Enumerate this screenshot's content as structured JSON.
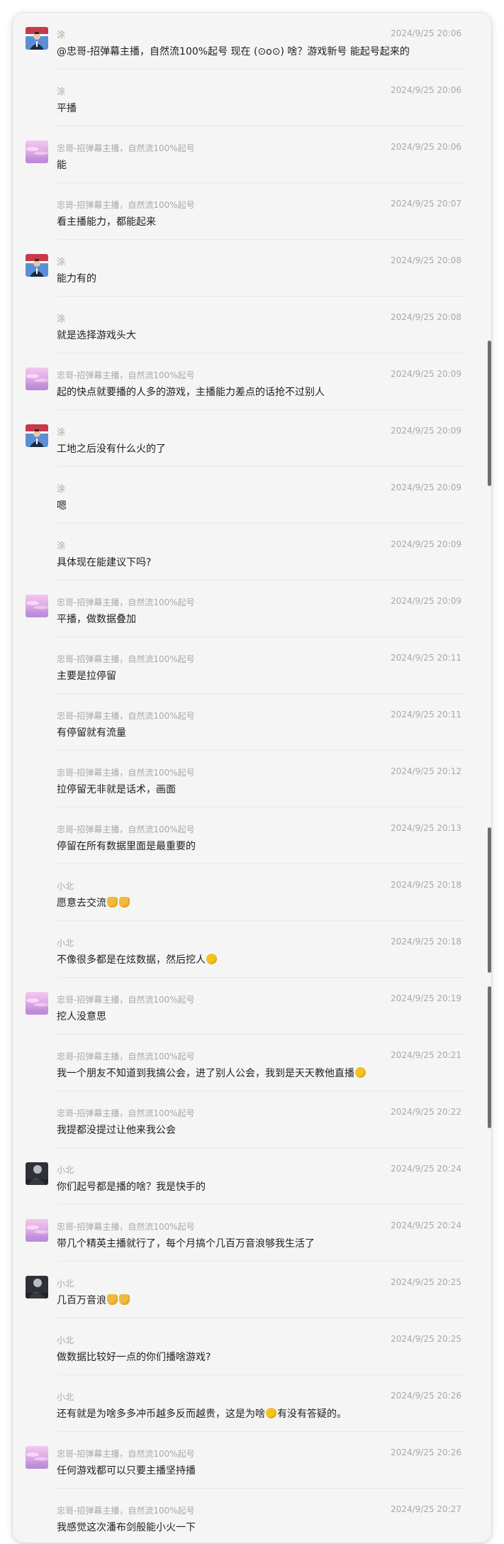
{
  "avatars": {
    "tu": "flag-portrait",
    "zhongge": "pink-sky",
    "xiaobei": "dark-figure"
  },
  "messages": [
    {
      "avatar": "tu",
      "sender": "涂",
      "time": "2024/9/25 20:06",
      "text": "@忠哥-招弹幕主播，自然流100%起号 现在 (⊙o⊙) 啥？游戏新号  能起号起来的"
    },
    {
      "avatar": "",
      "sender": "涂",
      "time": "2024/9/25 20:06",
      "text": "平播"
    },
    {
      "avatar": "zhongge",
      "sender": "忠哥-招弹幕主播，自然流100%起号",
      "time": "2024/9/25 20:06",
      "text": "能"
    },
    {
      "avatar": "",
      "sender": "忠哥-招弹幕主播，自然流100%起号",
      "time": "2024/9/25 20:07",
      "text": "看主播能力，都能起来"
    },
    {
      "avatar": "tu",
      "sender": "涂",
      "time": "2024/9/25 20:08",
      "text": "能力有的"
    },
    {
      "avatar": "",
      "sender": "涂",
      "time": "2024/9/25 20:08",
      "text": "就是选择游戏头大"
    },
    {
      "avatar": "zhongge",
      "sender": "忠哥-招弹幕主播，自然流100%起号",
      "time": "2024/9/25 20:09",
      "text": "起的快点就要播的人多的游戏，主播能力差点的话抢不过别人"
    },
    {
      "avatar": "tu",
      "sender": "涂",
      "time": "2024/9/25 20:09",
      "text": "工地之后没有什么火的了"
    },
    {
      "avatar": "",
      "sender": "涂",
      "time": "2024/9/25 20:09",
      "text": "嗯"
    },
    {
      "avatar": "",
      "sender": "涂",
      "time": "2024/9/25 20:09",
      "text": "具体现在能建议下吗?"
    },
    {
      "avatar": "zhongge",
      "sender": "忠哥-招弹幕主播，自然流100%起号",
      "time": "2024/9/25 20:09",
      "text": "平播，做数据叠加"
    },
    {
      "avatar": "",
      "sender": "忠哥-招弹幕主播，自然流100%起号",
      "time": "2024/9/25 20:11",
      "text": "主要是拉停留"
    },
    {
      "avatar": "",
      "sender": "忠哥-招弹幕主播，自然流100%起号",
      "time": "2024/9/25 20:11",
      "text": "有停留就有流量"
    },
    {
      "avatar": "",
      "sender": "忠哥-招弹幕主播，自然流100%起号",
      "time": "2024/9/25 20:12",
      "text": "拉停留无非就是话术，画面"
    },
    {
      "avatar": "",
      "sender": "忠哥-招弹幕主播，自然流100%起号",
      "time": "2024/9/25 20:13",
      "text": "停留在所有数据里面是最重要的"
    },
    {
      "avatar": "",
      "sender": "小北",
      "time": "2024/9/25 20:18",
      "text": "愿意去交流",
      "emoji": [
        "thumb",
        "thumb"
      ]
    },
    {
      "avatar": "",
      "sender": "小北",
      "time": "2024/9/25 20:18",
      "text": "不像很多都是在炫数据，然后挖人",
      "emoji": [
        "face"
      ]
    },
    {
      "avatar": "zhongge",
      "sender": "忠哥-招弹幕主播，自然流100%起号",
      "time": "2024/9/25 20:19",
      "text": "挖人没意思"
    },
    {
      "avatar": "",
      "sender": "忠哥-招弹幕主播，自然流100%起号",
      "time": "2024/9/25 20:21",
      "text": "我一个朋友不知道到我搞公会，进了别人公会，我到是天天教他直播",
      "emoji": [
        "face"
      ]
    },
    {
      "avatar": "",
      "sender": "忠哥-招弹幕主播，自然流100%起号",
      "time": "2024/9/25 20:22",
      "text": "我提都没提过让他来我公会"
    },
    {
      "avatar": "xiaobei",
      "sender": "小北",
      "time": "2024/9/25 20:24",
      "text": "你们起号都是播的啥？我是快手的"
    },
    {
      "avatar": "zhongge",
      "sender": "忠哥-招弹幕主播，自然流100%起号",
      "time": "2024/9/25 20:24",
      "text": "带几个精英主播就行了，每个月搞个几百万音浪够我生活了"
    },
    {
      "avatar": "xiaobei",
      "sender": "小北",
      "time": "2024/9/25 20:25",
      "text": "几百万音浪",
      "emoji": [
        "thumb",
        "thumb"
      ]
    },
    {
      "avatar": "",
      "sender": "小北",
      "time": "2024/9/25 20:25",
      "text": "做数据比较好一点的你们播啥游戏?"
    },
    {
      "avatar": "",
      "sender": "小北",
      "time": "2024/9/25 20:26",
      "text": "还有就是为啥多多冲币越多反而越贵，这是为啥",
      "emoji": [
        "face"
      ],
      "text_after": "有没有答疑的。"
    },
    {
      "avatar": "zhongge",
      "sender": "忠哥-招弹幕主播，自然流100%起号",
      "time": "2024/9/25 20:26",
      "text": "任何游戏都可以只要主播坚持播"
    },
    {
      "avatar": "",
      "sender": "忠哥-招弹幕主播，自然流100%起号",
      "time": "2024/9/25 20:27",
      "text": "我感觉这次潘布剑般能小火一下"
    }
  ]
}
